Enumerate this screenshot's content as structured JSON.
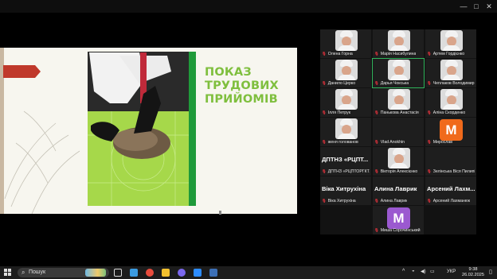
{
  "window": {
    "controls": {
      "minimize": "—",
      "maximize": "□",
      "close": "✕"
    }
  },
  "slide": {
    "title_lines": [
      "ПОКАЗ",
      "ТРУДОВИХ",
      "ПРИЙОМІВ"
    ],
    "colors": {
      "title": "#7fbf3e",
      "green_bar": "#1f9a3a",
      "arrow": "#c0392b",
      "mat": "#a6d84a"
    }
  },
  "gallery": {
    "tiles": [
      {
        "name": "Олена Горна",
        "kind": "photo"
      },
      {
        "name": "Марія Насибулина",
        "kind": "photo"
      },
      {
        "name": "Артем Гордієнко",
        "kind": "photo"
      },
      {
        "name": "Данило Церко",
        "kind": "photo"
      },
      {
        "name": "Дарья Чокська",
        "kind": "photo",
        "active": true
      },
      {
        "name": "Чеплаков Володимир",
        "kind": "photo"
      },
      {
        "name": "Ілля Петрук",
        "kind": "photo"
      },
      {
        "name": "Панькова Анастасія",
        "kind": "photo"
      },
      {
        "name": "Аліна Скорденко",
        "kind": "photo"
      },
      {
        "name": "женя голованов",
        "kind": "photo"
      },
      {
        "name": "Vlad Anokhin",
        "kind": "blank"
      },
      {
        "name": "Мирослав",
        "kind": "avatar",
        "letter": "M",
        "color": "#f06a1b"
      },
      {
        "name": "ДПТНЗ «РЦПТОРГКТ...",
        "kind": "big",
        "big": "ДПТНЗ «РЦПТ..."
      },
      {
        "name": "Вікторія Алексієнко",
        "kind": "photo"
      },
      {
        "name": "Зелінська Віся Пилипі...",
        "kind": "blank"
      },
      {
        "name": "Віка Хитрухіна",
        "kind": "big",
        "big": "Віка Хитрухіна"
      },
      {
        "name": "Алина Лаврик",
        "kind": "big",
        "big": "Алина Лаврик"
      },
      {
        "name": "Арсений Лахманюк",
        "kind": "big",
        "big": "Арсений Лахм..."
      },
      {
        "name": "Миша Сорочинський",
        "kind": "avatar",
        "letter": "M",
        "color": "#9b59d0"
      }
    ]
  },
  "taskbar": {
    "search_placeholder": "Пошук",
    "tray_arrow": "^",
    "language": "УКР",
    "time": "9:38",
    "date": "26.02.2025",
    "app_colors": [
      "#2c6fd6",
      "#3b9be0",
      "#e84c3d",
      "#f2c02f",
      "#7b68ee",
      "#2d8cff",
      "#3c6fb5"
    ]
  }
}
